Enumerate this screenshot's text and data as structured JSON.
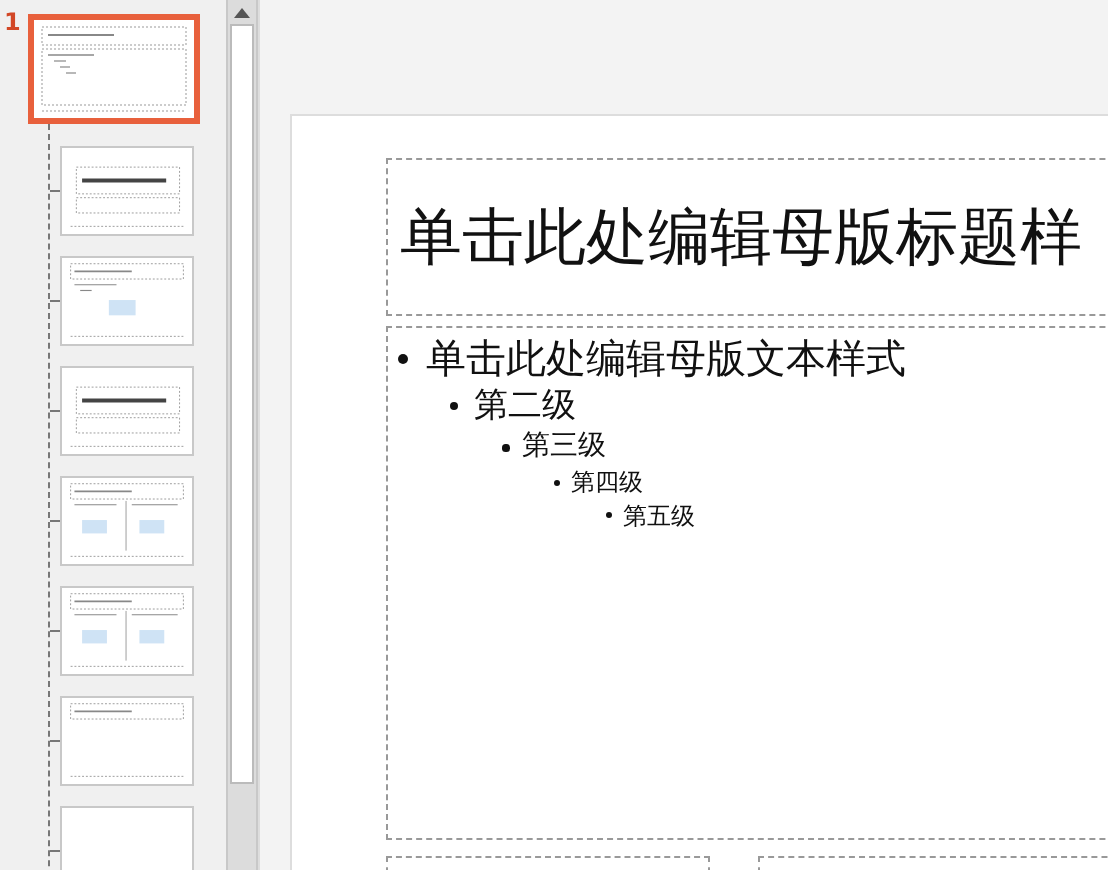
{
  "thumbnails_panel": {
    "number": "1",
    "thumbnails": [
      {
        "kind": "master",
        "selected": true
      },
      {
        "kind": "title",
        "selected": false
      },
      {
        "kind": "content",
        "selected": false
      },
      {
        "kind": "section",
        "selected": false
      },
      {
        "kind": "two_content",
        "selected": false
      },
      {
        "kind": "comparison",
        "selected": false
      },
      {
        "kind": "title_only",
        "selected": false
      },
      {
        "kind": "blank",
        "selected": false
      }
    ]
  },
  "slide": {
    "title": "单击此处编辑母版标题样",
    "body_levels": [
      "单击此处编辑母版文本样式",
      "第二级",
      "第三级",
      "第四级",
      "第五级"
    ]
  }
}
